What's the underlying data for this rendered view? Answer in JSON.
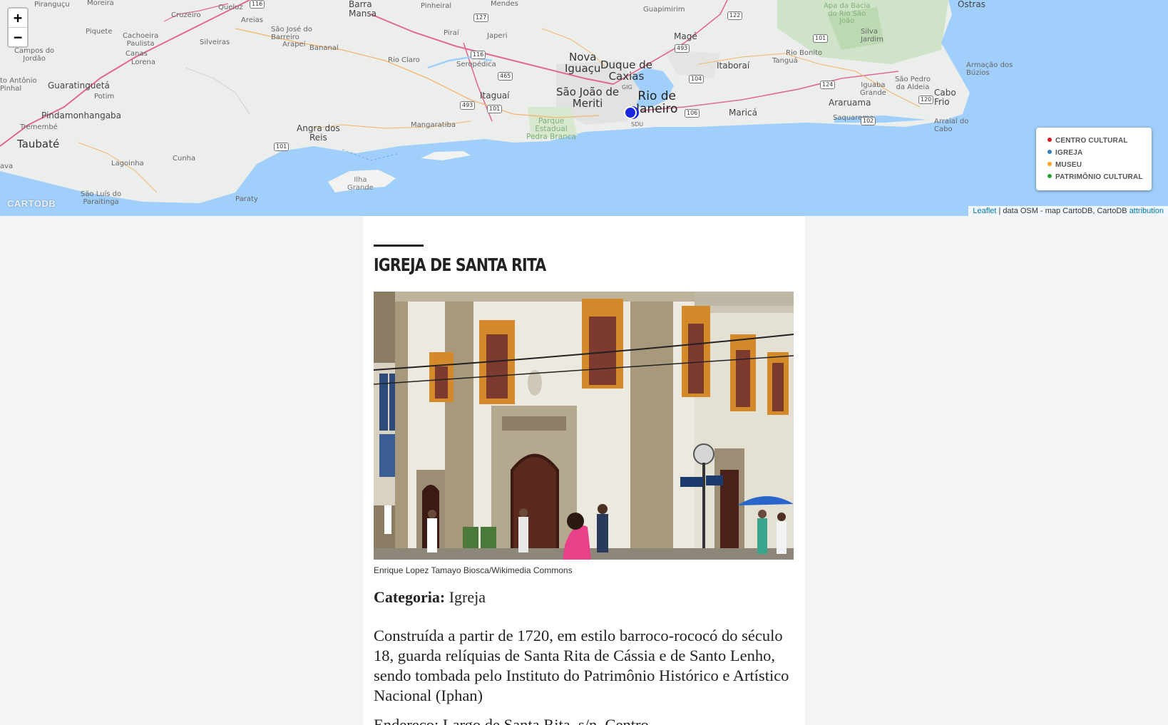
{
  "map": {
    "zoom_in_label": "+",
    "zoom_out_label": "−",
    "logo_text": "CARTODB",
    "attribution": {
      "leaflet_link": "Leaflet",
      "text": " | data OSM - map CartoDB, CartoDB ",
      "attribution_link": "attribution"
    },
    "legend": [
      {
        "label": "CENTRO CULTURAL",
        "color": "#e41a1c"
      },
      {
        "label": "IGREJA",
        "color": "#377eb8"
      },
      {
        "label": "MUSEU",
        "color": "#ff9f1c"
      },
      {
        "label": "PATRIMÔNIO CULTURAL",
        "color": "#2ca02c"
      }
    ],
    "marker_color": "#1a28e0",
    "places": {
      "piranguçu": "Piranguçu",
      "moreira": "Moreira",
      "cruzeiro": "Cruzeiro",
      "queluz": "Queluz",
      "areias": "Areias",
      "barra_mansa": "Barra\nMansa",
      "pinheiral": "Pinheiral",
      "mendes": "Mendes",
      "guapimirim": "Guapimirim",
      "ostras": "Ostras",
      "apa": "Apa da Bacia\ndo Rio São\nJoão",
      "piquete": "Piquete",
      "cachoeira_paulista": "Cachoeira\nPaulista",
      "silveiras": "Silveiras",
      "sao_jose_barreiro": "São José do\nBarreiro",
      "arapei": "Arapeí",
      "bananal": "Bananal",
      "pirai": "Piraí",
      "japeri": "Japeri",
      "mage": "Magé",
      "silva_jardim": "Silva\nJardim",
      "campos_jordao": "Campos do\nJordão",
      "canas": "Canas",
      "lorena": "Lorena",
      "rio_claro": "Rio Claro",
      "seropedica": "Seropédica",
      "nova_iguacu": "Nova\nIguaçu",
      "duque_caxias": "Duque de\nCaxias",
      "itaborai": "Itaboraí",
      "tangua": "Tanguá",
      "rio_bonito": "Rio Bonito",
      "armacao_buzios": "Armação dos\nBúzios",
      "santo_antonio_pinhal": "to Antônio\nPinhal",
      "guaratingueta": "Guaratinguetá",
      "potim": "Potim",
      "itaguai": "Itaguaí",
      "sao_joao_meriti": "São João de\nMeriti",
      "gig": "GIG",
      "rio_janeiro": "Rio de\nJaneiro",
      "iguaba_grande": "Iguaba\nGrande",
      "sao_pedro_aldeia": "São Pedro\nda Aldeia",
      "cabo_frio": "Cabo\nFrio",
      "pindamonhangaba": "Pindamonhangaba",
      "araruama": "Araruama",
      "tremembe": "Tremembé",
      "angra_reis": "Angra dos\nReis",
      "mangaratiba": "Mangaratiba",
      "parque_pedra_branca": "Parque\nEstadual\nPedra Branca",
      "sdu": "SDU",
      "marica": "Maricá",
      "saquarema": "Saquarema",
      "arraial_cabo": "Arraial do\nCabo",
      "taubate": "Taubaté",
      "ava": "ava",
      "lagoinha": "Lagoinha",
      "cunha": "Cunha",
      "ilha_grande": "Ilha\nGrande",
      "sao_luis_paraitinga": "São Luís do\nParaitinga",
      "paraty": "Paraty"
    },
    "shields": {
      "s116a": "116",
      "s127": "127",
      "s122": "122",
      "s493a": "493",
      "s101a": "101",
      "s116b": "116",
      "s465": "465",
      "s104": "104",
      "s493b": "493",
      "s101b": "101",
      "s106": "106",
      "s124": "124",
      "s120": "120",
      "s102": "102",
      "s101c": "101"
    }
  },
  "article": {
    "title": "IGREJA DE SANTA RITA",
    "photo_caption": "Enrique Lopez Tamayo Biosca/Wikimedia Commons",
    "category_label": "Categoria:",
    "category_value": " Igreja",
    "description": "Construída a partir de 1720, em estilo barroco-rococó do século 18, guarda relíquias de Santa Rita de Cássia e de Santo Lenho, sendo tombada pelo Instituto do Patrimônio Histórico e Artístico Nacional (Iphan)",
    "next_paragraph": "Endereço: Largo de Santa Rita, s/n, Centro"
  }
}
